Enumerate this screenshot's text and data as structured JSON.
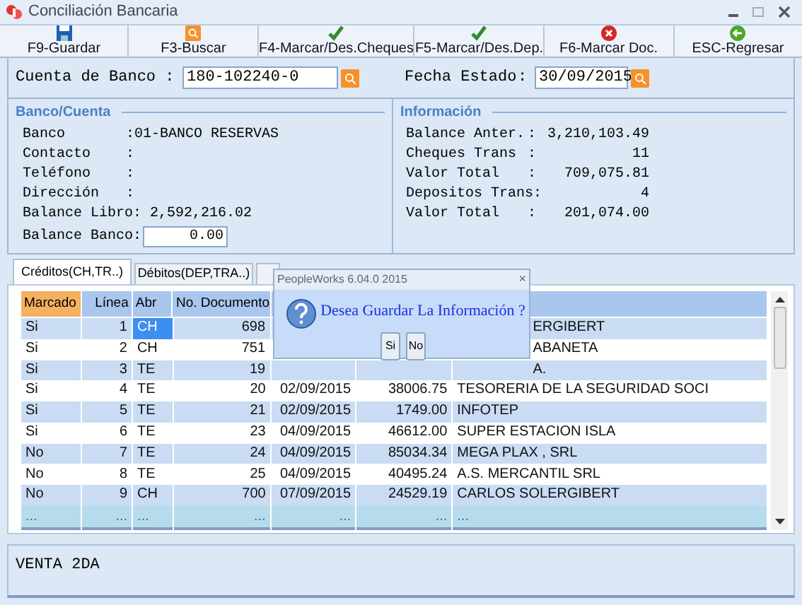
{
  "window": {
    "title": "Conciliación Bancaria"
  },
  "toolbar": [
    {
      "label": "F9-Guardar",
      "kind": "save"
    },
    {
      "label": "F3-Buscar",
      "kind": "search"
    },
    {
      "label": "F4-Marcar/Des.Cheques",
      "kind": "check"
    },
    {
      "label": "F5-Marcar/Des.Dep.",
      "kind": "check"
    },
    {
      "label": "F6-Marcar Doc.",
      "kind": "cancel"
    },
    {
      "label": "ESC-Regresar",
      "kind": "back"
    }
  ],
  "account": {
    "label": "Cuenta de Banco :",
    "value": "180-102240-0"
  },
  "statement_date": {
    "label": "Fecha Estado",
    "colon": ":",
    "value": "30/09/2015"
  },
  "bank_group": {
    "title": "Banco/Cuenta",
    "fields": [
      {
        "label": "Banco",
        "value": ":01-BANCO RESERVAS"
      },
      {
        "label": "Contacto",
        "value": ":"
      },
      {
        "label": "Teléfono",
        "value": ":"
      },
      {
        "label": "Dirección",
        "value": ":"
      },
      {
        "label": "Balance Libro:",
        "value": "2,592,216.02"
      },
      {
        "label": "Balance Banco:",
        "value": "0.00",
        "kind": "input"
      }
    ]
  },
  "info_group": {
    "title": "Información",
    "fields": [
      {
        "label": "Balance Anter.",
        "colon": ":",
        "value": "3,210,103.49"
      },
      {
        "label": "Cheques Trans",
        "colon": ":",
        "value": "11"
      },
      {
        "label": "Valor Total",
        "colon": ":",
        "value": "709,075.81"
      },
      {
        "label": "Depositos Trans:",
        "value": "4"
      },
      {
        "label": "Valor Total",
        "colon": ":",
        "value": "201,074.00"
      }
    ]
  },
  "tabs": [
    {
      "label": "Créditos(CH,TR..)",
      "selected": true
    },
    {
      "label": "Débitos(DEP,TRA..)",
      "selected": false
    },
    {
      "selected": false
    }
  ],
  "table": {
    "columns": [
      "Marcado",
      "Línea",
      "Abr",
      "No. Documento",
      null,
      null,
      null
    ],
    "rows": [
      {
        "selected": true,
        "cells": [
          "Si",
          "1",
          "CH",
          "698",
          null,
          null,
          "ERGIBERT"
        ],
        "covered": true
      },
      {
        "selected": false,
        "cells": [
          "Si",
          "2",
          "CH",
          "751",
          null,
          null,
          "ABANETA"
        ],
        "covered": true
      },
      {
        "selected": false,
        "cells": [
          "Si",
          "3",
          "TE",
          "19",
          null,
          null,
          "A."
        ],
        "covered": true
      },
      {
        "selected": false,
        "cells": [
          "Si",
          "4",
          "TE",
          "20",
          "02/09/2015",
          "38006.75",
          "TESORERIA DE LA SEGURIDAD SOCI"
        ]
      },
      {
        "selected": false,
        "cells": [
          "Si",
          "5",
          "TE",
          "21",
          "02/09/2015",
          "1749.00",
          "INFOTEP"
        ]
      },
      {
        "selected": false,
        "cells": [
          "Si",
          "6",
          "TE",
          "23",
          "04/09/2015",
          "46612.00",
          "SUPER ESTACION ISLA"
        ]
      },
      {
        "selected": false,
        "cells": [
          "No",
          "7",
          "TE",
          "24",
          "04/09/2015",
          "85034.34",
          "MEGA PLAX , SRL"
        ]
      },
      {
        "selected": false,
        "cells": [
          "No",
          "8",
          "TE",
          "25",
          "04/09/2015",
          "40495.24",
          "A.S. MERCANTIL SRL"
        ]
      },
      {
        "selected": false,
        "cells": [
          "No",
          "9",
          "CH",
          "700",
          "07/09/2015",
          "24529.19",
          "CARLOS SOLERGIBERT"
        ]
      }
    ],
    "footer": [
      "...",
      "...",
      "...",
      "...",
      "...",
      "...",
      "..."
    ]
  },
  "memo": "VENTA 2DA",
  "dialog": {
    "title": "PeopleWorks 6.04.0 2015",
    "close": "×",
    "message": "Desea Guardar La Información ?",
    "buttons": [
      "Si",
      "No"
    ]
  }
}
